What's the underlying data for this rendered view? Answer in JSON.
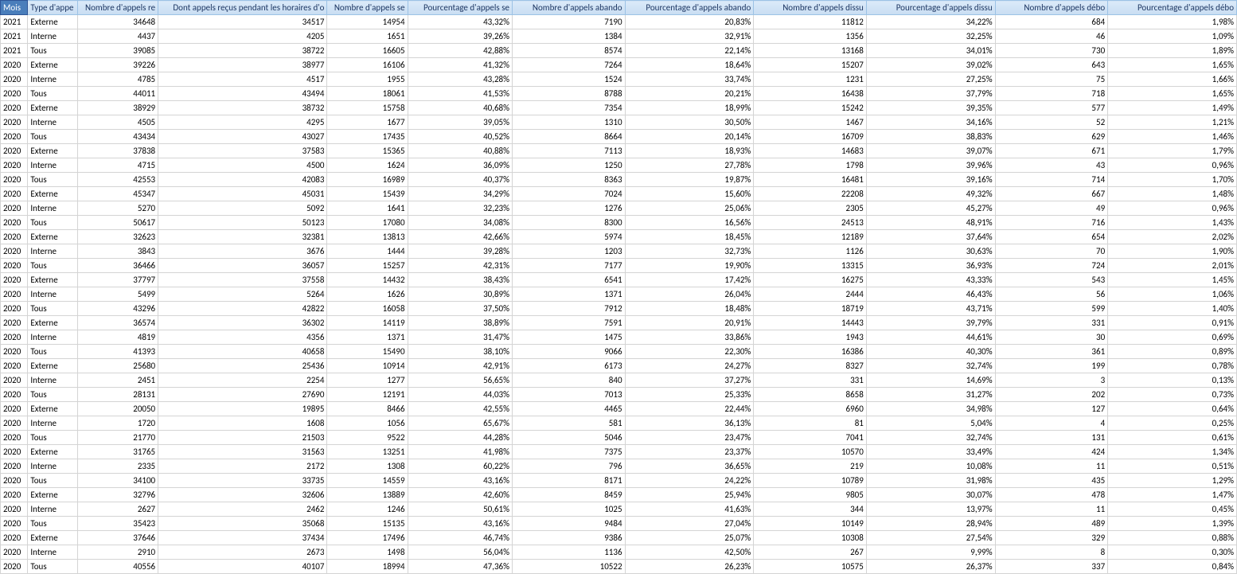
{
  "headers": {
    "mois": "Mois",
    "type": "Type d'appe",
    "nrec": "Nombre d'appels re",
    "nrecho": "Dont appels reçus pendant les horaires d'o",
    "nserv": "Nombre d'appels se",
    "pserv": "Pourcentage d'appels se",
    "nabd": "Nombre d'appels abando",
    "pabd": "Pourcentage d'appels abando",
    "ndis": "Nombre d'appels dissu",
    "pdis": "Pourcentage d'appels dissu",
    "ndeb": "Nombre d'appels débo",
    "pdeb": "Pourcentage d'appels débo"
  },
  "rows": [
    {
      "mois": "2021",
      "type": "Externe",
      "nrec": "34648",
      "nrecho": "34517",
      "nserv": "14954",
      "pserv": "43,32%",
      "nabd": "7190",
      "pabd": "20,83%",
      "ndis": "11812",
      "pdis": "34,22%",
      "ndeb": "684",
      "pdeb": "1,98%"
    },
    {
      "mois": "2021",
      "type": "Interne",
      "nrec": "4437",
      "nrecho": "4205",
      "nserv": "1651",
      "pserv": "39,26%",
      "nabd": "1384",
      "pabd": "32,91%",
      "ndis": "1356",
      "pdis": "32,25%",
      "ndeb": "46",
      "pdeb": "1,09%"
    },
    {
      "mois": "2021",
      "type": "Tous",
      "nrec": "39085",
      "nrecho": "38722",
      "nserv": "16605",
      "pserv": "42,88%",
      "nabd": "8574",
      "pabd": "22,14%",
      "ndis": "13168",
      "pdis": "34,01%",
      "ndeb": "730",
      "pdeb": "1,89%"
    },
    {
      "mois": "2020",
      "type": "Externe",
      "nrec": "39226",
      "nrecho": "38977",
      "nserv": "16106",
      "pserv": "41,32%",
      "nabd": "7264",
      "pabd": "18,64%",
      "ndis": "15207",
      "pdis": "39,02%",
      "ndeb": "643",
      "pdeb": "1,65%"
    },
    {
      "mois": "2020",
      "type": "Interne",
      "nrec": "4785",
      "nrecho": "4517",
      "nserv": "1955",
      "pserv": "43,28%",
      "nabd": "1524",
      "pabd": "33,74%",
      "ndis": "1231",
      "pdis": "27,25%",
      "ndeb": "75",
      "pdeb": "1,66%"
    },
    {
      "mois": "2020",
      "type": "Tous",
      "nrec": "44011",
      "nrecho": "43494",
      "nserv": "18061",
      "pserv": "41,53%",
      "nabd": "8788",
      "pabd": "20,21%",
      "ndis": "16438",
      "pdis": "37,79%",
      "ndeb": "718",
      "pdeb": "1,65%"
    },
    {
      "mois": "2020",
      "type": "Externe",
      "nrec": "38929",
      "nrecho": "38732",
      "nserv": "15758",
      "pserv": "40,68%",
      "nabd": "7354",
      "pabd": "18,99%",
      "ndis": "15242",
      "pdis": "39,35%",
      "ndeb": "577",
      "pdeb": "1,49%"
    },
    {
      "mois": "2020",
      "type": "Interne",
      "nrec": "4505",
      "nrecho": "4295",
      "nserv": "1677",
      "pserv": "39,05%",
      "nabd": "1310",
      "pabd": "30,50%",
      "ndis": "1467",
      "pdis": "34,16%",
      "ndeb": "52",
      "pdeb": "1,21%"
    },
    {
      "mois": "2020",
      "type": "Tous",
      "nrec": "43434",
      "nrecho": "43027",
      "nserv": "17435",
      "pserv": "40,52%",
      "nabd": "8664",
      "pabd": "20,14%",
      "ndis": "16709",
      "pdis": "38,83%",
      "ndeb": "629",
      "pdeb": "1,46%"
    },
    {
      "mois": "2020",
      "type": "Externe",
      "nrec": "37838",
      "nrecho": "37583",
      "nserv": "15365",
      "pserv": "40,88%",
      "nabd": "7113",
      "pabd": "18,93%",
      "ndis": "14683",
      "pdis": "39,07%",
      "ndeb": "671",
      "pdeb": "1,79%"
    },
    {
      "mois": "2020",
      "type": "Interne",
      "nrec": "4715",
      "nrecho": "4500",
      "nserv": "1624",
      "pserv": "36,09%",
      "nabd": "1250",
      "pabd": "27,78%",
      "ndis": "1798",
      "pdis": "39,96%",
      "ndeb": "43",
      "pdeb": "0,96%"
    },
    {
      "mois": "2020",
      "type": "Tous",
      "nrec": "42553",
      "nrecho": "42083",
      "nserv": "16989",
      "pserv": "40,37%",
      "nabd": "8363",
      "pabd": "19,87%",
      "ndis": "16481",
      "pdis": "39,16%",
      "ndeb": "714",
      "pdeb": "1,70%"
    },
    {
      "mois": "2020",
      "type": "Externe",
      "nrec": "45347",
      "nrecho": "45031",
      "nserv": "15439",
      "pserv": "34,29%",
      "nabd": "7024",
      "pabd": "15,60%",
      "ndis": "22208",
      "pdis": "49,32%",
      "ndeb": "667",
      "pdeb": "1,48%"
    },
    {
      "mois": "2020",
      "type": "Interne",
      "nrec": "5270",
      "nrecho": "5092",
      "nserv": "1641",
      "pserv": "32,23%",
      "nabd": "1276",
      "pabd": "25,06%",
      "ndis": "2305",
      "pdis": "45,27%",
      "ndeb": "49",
      "pdeb": "0,96%"
    },
    {
      "mois": "2020",
      "type": "Tous",
      "nrec": "50617",
      "nrecho": "50123",
      "nserv": "17080",
      "pserv": "34,08%",
      "nabd": "8300",
      "pabd": "16,56%",
      "ndis": "24513",
      "pdis": "48,91%",
      "ndeb": "716",
      "pdeb": "1,43%"
    },
    {
      "mois": "2020",
      "type": "Externe",
      "nrec": "32623",
      "nrecho": "32381",
      "nserv": "13813",
      "pserv": "42,66%",
      "nabd": "5974",
      "pabd": "18,45%",
      "ndis": "12189",
      "pdis": "37,64%",
      "ndeb": "654",
      "pdeb": "2,02%"
    },
    {
      "mois": "2020",
      "type": "Interne",
      "nrec": "3843",
      "nrecho": "3676",
      "nserv": "1444",
      "pserv": "39,28%",
      "nabd": "1203",
      "pabd": "32,73%",
      "ndis": "1126",
      "pdis": "30,63%",
      "ndeb": "70",
      "pdeb": "1,90%"
    },
    {
      "mois": "2020",
      "type": "Tous",
      "nrec": "36466",
      "nrecho": "36057",
      "nserv": "15257",
      "pserv": "42,31%",
      "nabd": "7177",
      "pabd": "19,90%",
      "ndis": "13315",
      "pdis": "36,93%",
      "ndeb": "724",
      "pdeb": "2,01%"
    },
    {
      "mois": "2020",
      "type": "Externe",
      "nrec": "37797",
      "nrecho": "37558",
      "nserv": "14432",
      "pserv": "38,43%",
      "nabd": "6541",
      "pabd": "17,42%",
      "ndis": "16275",
      "pdis": "43,33%",
      "ndeb": "543",
      "pdeb": "1,45%"
    },
    {
      "mois": "2020",
      "type": "Interne",
      "nrec": "5499",
      "nrecho": "5264",
      "nserv": "1626",
      "pserv": "30,89%",
      "nabd": "1371",
      "pabd": "26,04%",
      "ndis": "2444",
      "pdis": "46,43%",
      "ndeb": "56",
      "pdeb": "1,06%"
    },
    {
      "mois": "2020",
      "type": "Tous",
      "nrec": "43296",
      "nrecho": "42822",
      "nserv": "16058",
      "pserv": "37,50%",
      "nabd": "7912",
      "pabd": "18,48%",
      "ndis": "18719",
      "pdis": "43,71%",
      "ndeb": "599",
      "pdeb": "1,40%"
    },
    {
      "mois": "2020",
      "type": "Externe",
      "nrec": "36574",
      "nrecho": "36302",
      "nserv": "14119",
      "pserv": "38,89%",
      "nabd": "7591",
      "pabd": "20,91%",
      "ndis": "14443",
      "pdis": "39,79%",
      "ndeb": "331",
      "pdeb": "0,91%"
    },
    {
      "mois": "2020",
      "type": "Interne",
      "nrec": "4819",
      "nrecho": "4356",
      "nserv": "1371",
      "pserv": "31,47%",
      "nabd": "1475",
      "pabd": "33,86%",
      "ndis": "1943",
      "pdis": "44,61%",
      "ndeb": "30",
      "pdeb": "0,69%"
    },
    {
      "mois": "2020",
      "type": "Tous",
      "nrec": "41393",
      "nrecho": "40658",
      "nserv": "15490",
      "pserv": "38,10%",
      "nabd": "9066",
      "pabd": "22,30%",
      "ndis": "16386",
      "pdis": "40,30%",
      "ndeb": "361",
      "pdeb": "0,89%"
    },
    {
      "mois": "2020",
      "type": "Externe",
      "nrec": "25680",
      "nrecho": "25436",
      "nserv": "10914",
      "pserv": "42,91%",
      "nabd": "6173",
      "pabd": "24,27%",
      "ndis": "8327",
      "pdis": "32,74%",
      "ndeb": "199",
      "pdeb": "0,78%"
    },
    {
      "mois": "2020",
      "type": "Interne",
      "nrec": "2451",
      "nrecho": "2254",
      "nserv": "1277",
      "pserv": "56,65%",
      "nabd": "840",
      "pabd": "37,27%",
      "ndis": "331",
      "pdis": "14,69%",
      "ndeb": "3",
      "pdeb": "0,13%"
    },
    {
      "mois": "2020",
      "type": "Tous",
      "nrec": "28131",
      "nrecho": "27690",
      "nserv": "12191",
      "pserv": "44,03%",
      "nabd": "7013",
      "pabd": "25,33%",
      "ndis": "8658",
      "pdis": "31,27%",
      "ndeb": "202",
      "pdeb": "0,73%"
    },
    {
      "mois": "2020",
      "type": "Externe",
      "nrec": "20050",
      "nrecho": "19895",
      "nserv": "8466",
      "pserv": "42,55%",
      "nabd": "4465",
      "pabd": "22,44%",
      "ndis": "6960",
      "pdis": "34,98%",
      "ndeb": "127",
      "pdeb": "0,64%"
    },
    {
      "mois": "2020",
      "type": "Interne",
      "nrec": "1720",
      "nrecho": "1608",
      "nserv": "1056",
      "pserv": "65,67%",
      "nabd": "581",
      "pabd": "36,13%",
      "ndis": "81",
      "pdis": "5,04%",
      "ndeb": "4",
      "pdeb": "0,25%"
    },
    {
      "mois": "2020",
      "type": "Tous",
      "nrec": "21770",
      "nrecho": "21503",
      "nserv": "9522",
      "pserv": "44,28%",
      "nabd": "5046",
      "pabd": "23,47%",
      "ndis": "7041",
      "pdis": "32,74%",
      "ndeb": "131",
      "pdeb": "0,61%"
    },
    {
      "mois": "2020",
      "type": "Externe",
      "nrec": "31765",
      "nrecho": "31563",
      "nserv": "13251",
      "pserv": "41,98%",
      "nabd": "7375",
      "pabd": "23,37%",
      "ndis": "10570",
      "pdis": "33,49%",
      "ndeb": "424",
      "pdeb": "1,34%"
    },
    {
      "mois": "2020",
      "type": "Interne",
      "nrec": "2335",
      "nrecho": "2172",
      "nserv": "1308",
      "pserv": "60,22%",
      "nabd": "796",
      "pabd": "36,65%",
      "ndis": "219",
      "pdis": "10,08%",
      "ndeb": "11",
      "pdeb": "0,51%"
    },
    {
      "mois": "2020",
      "type": "Tous",
      "nrec": "34100",
      "nrecho": "33735",
      "nserv": "14559",
      "pserv": "43,16%",
      "nabd": "8171",
      "pabd": "24,22%",
      "ndis": "10789",
      "pdis": "31,98%",
      "ndeb": "435",
      "pdeb": "1,29%"
    },
    {
      "mois": "2020",
      "type": "Externe",
      "nrec": "32796",
      "nrecho": "32606",
      "nserv": "13889",
      "pserv": "42,60%",
      "nabd": "8459",
      "pabd": "25,94%",
      "ndis": "9805",
      "pdis": "30,07%",
      "ndeb": "478",
      "pdeb": "1,47%"
    },
    {
      "mois": "2020",
      "type": "Interne",
      "nrec": "2627",
      "nrecho": "2462",
      "nserv": "1246",
      "pserv": "50,61%",
      "nabd": "1025",
      "pabd": "41,63%",
      "ndis": "344",
      "pdis": "13,97%",
      "ndeb": "11",
      "pdeb": "0,45%"
    },
    {
      "mois": "2020",
      "type": "Tous",
      "nrec": "35423",
      "nrecho": "35068",
      "nserv": "15135",
      "pserv": "43,16%",
      "nabd": "9484",
      "pabd": "27,04%",
      "ndis": "10149",
      "pdis": "28,94%",
      "ndeb": "489",
      "pdeb": "1,39%"
    },
    {
      "mois": "2020",
      "type": "Externe",
      "nrec": "37646",
      "nrecho": "37434",
      "nserv": "17496",
      "pserv": "46,74%",
      "nabd": "9386",
      "pabd": "25,07%",
      "ndis": "10308",
      "pdis": "27,54%",
      "ndeb": "329",
      "pdeb": "0,88%"
    },
    {
      "mois": "2020",
      "type": "Interne",
      "nrec": "2910",
      "nrecho": "2673",
      "nserv": "1498",
      "pserv": "56,04%",
      "nabd": "1136",
      "pabd": "42,50%",
      "ndis": "267",
      "pdis": "9,99%",
      "ndeb": "8",
      "pdeb": "0,30%"
    },
    {
      "mois": "2020",
      "type": "Tous",
      "nrec": "40556",
      "nrecho": "40107",
      "nserv": "18994",
      "pserv": "47,36%",
      "nabd": "10522",
      "pabd": "26,23%",
      "ndis": "10575",
      "pdis": "26,37%",
      "ndeb": "337",
      "pdeb": "0,84%"
    }
  ]
}
